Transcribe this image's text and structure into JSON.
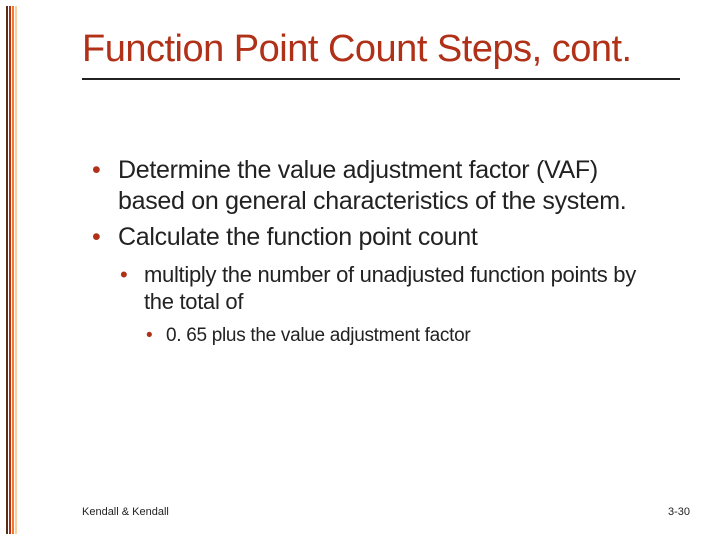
{
  "title": "Function Point Count Steps, cont.",
  "bullets": {
    "lvl1": [
      "Determine the value adjustment factor (VAF) based on general characteristics of the system.",
      "Calculate the function point count"
    ],
    "lvl2": [
      "multiply the number of unadjusted function points by the total of"
    ],
    "lvl3": [
      "0. 65 plus the value adjustment factor"
    ]
  },
  "footer": {
    "left": "Kendall & Kendall",
    "right": "3-30"
  }
}
